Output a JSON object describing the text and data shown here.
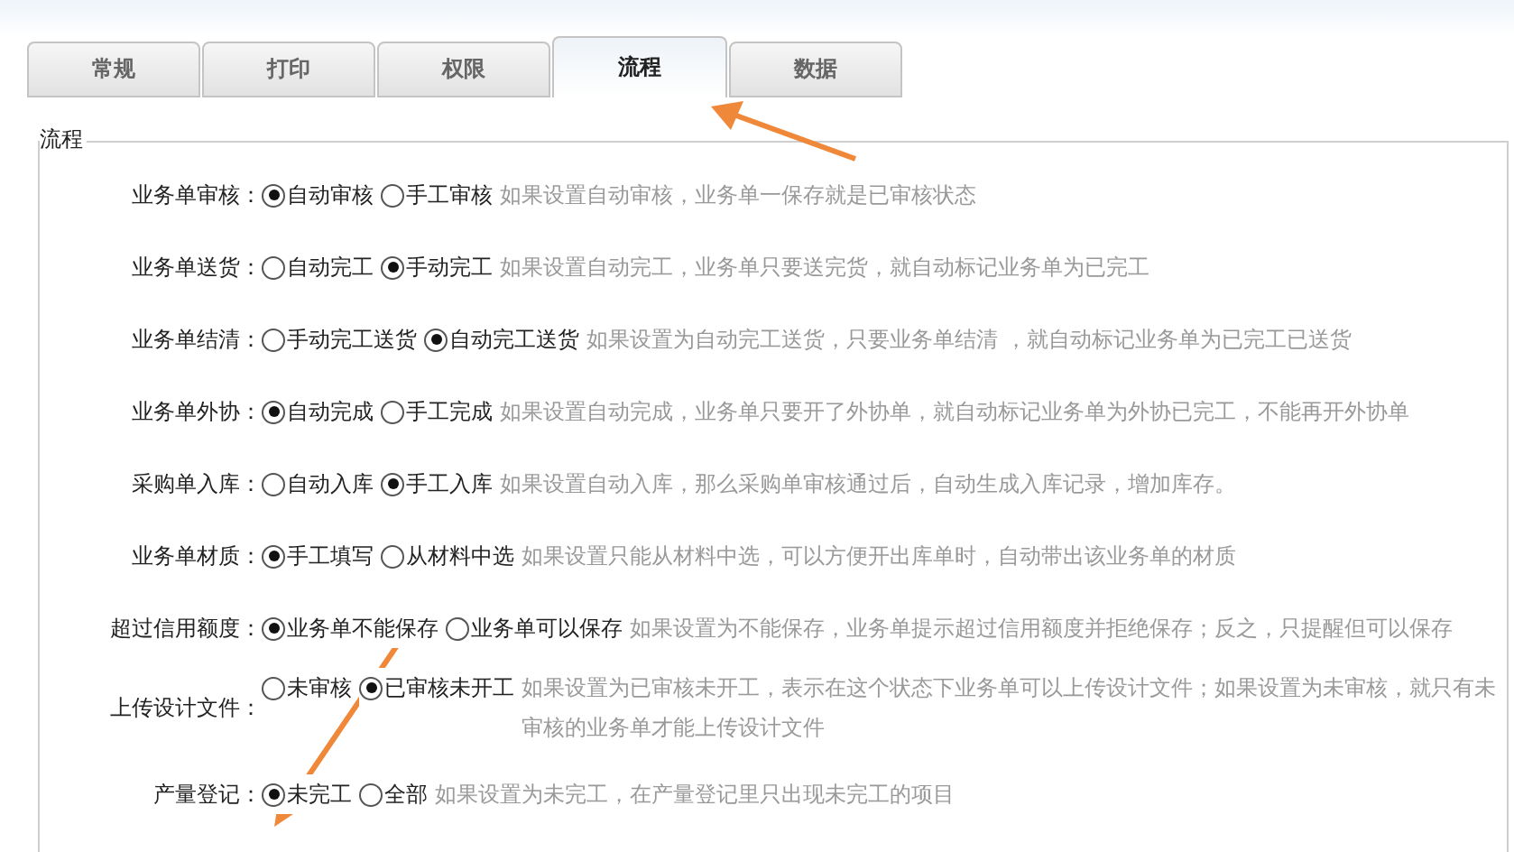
{
  "tabs": [
    {
      "label": "常规",
      "selected": false
    },
    {
      "label": "打印",
      "selected": false
    },
    {
      "label": "权限",
      "selected": false
    },
    {
      "label": "流程",
      "selected": true
    },
    {
      "label": "数据",
      "selected": false
    }
  ],
  "section": {
    "legend": "流程",
    "settings": [
      {
        "label": "业务单审核：",
        "options": [
          {
            "label": "自动审核",
            "selected": true
          },
          {
            "label": "手工审核",
            "selected": false
          }
        ],
        "description": "如果设置自动审核，业务单一保存就是已审核状态"
      },
      {
        "label": "业务单送货：",
        "options": [
          {
            "label": "自动完工",
            "selected": false
          },
          {
            "label": "手动完工",
            "selected": true
          }
        ],
        "description": "如果设置自动完工，业务单只要送完货，就自动标记业务单为已完工"
      },
      {
        "label": "业务单结清：",
        "options": [
          {
            "label": "手动完工送货",
            "selected": false
          },
          {
            "label": "自动完工送货",
            "selected": true
          }
        ],
        "description": "如果设置为自动完工送货，只要业务单结清 ，就自动标记业务单为已完工已送货"
      },
      {
        "label": "业务单外协：",
        "options": [
          {
            "label": "自动完成",
            "selected": true
          },
          {
            "label": "手工完成",
            "selected": false
          }
        ],
        "description": "如果设置自动完成，业务单只要开了外协单，就自动标记业务单为外协已完工，不能再开外协单"
      },
      {
        "label": "采购单入库：",
        "options": [
          {
            "label": "自动入库",
            "selected": false
          },
          {
            "label": "手工入库",
            "selected": true
          }
        ],
        "description": "如果设置自动入库，那么采购单审核通过后，自动生成入库记录，增加库存。"
      },
      {
        "label": "业务单材质：",
        "options": [
          {
            "label": "手工填写",
            "selected": true
          },
          {
            "label": "从材料中选",
            "selected": false
          }
        ],
        "description": "如果设置只能从材料中选，可以方便开出库单时，自动带出该业务单的材质"
      },
      {
        "label": "超过信用额度：",
        "options": [
          {
            "label": "业务单不能保存",
            "selected": true
          },
          {
            "label": "业务单可以保存",
            "selected": false
          }
        ],
        "description": "如果设置为不能保存，业务单提示超过信用额度并拒绝保存；反之，只提醒但可以保存"
      },
      {
        "label": "上传设计文件：",
        "options": [
          {
            "label": "未审核",
            "selected": false
          },
          {
            "label": "已审核未开工",
            "selected": true
          }
        ],
        "description": "如果设置为已审核未开工，表示在这个状态下业务单可以上传设计文件；如果设置为未审核，就只有未审核的业务单才能上传设计文件"
      },
      {
        "label": "产量登记：",
        "options": [
          {
            "label": "未完工",
            "selected": true
          },
          {
            "label": "全部",
            "selected": false
          }
        ],
        "description": "如果设置为未完工，在产量登记里只出现未完工的项目"
      }
    ]
  }
}
